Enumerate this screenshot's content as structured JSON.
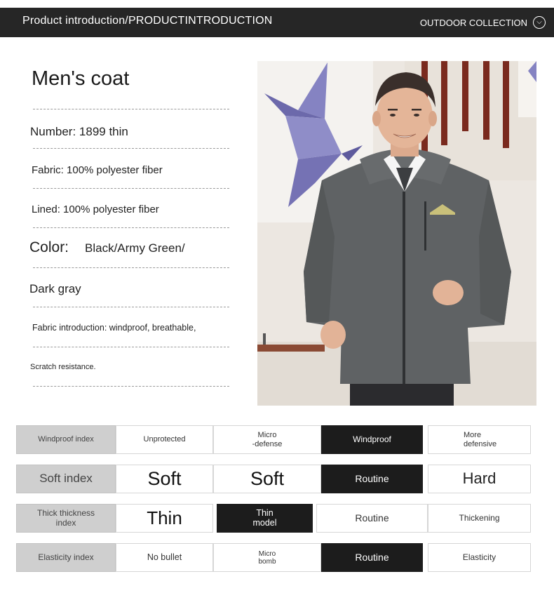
{
  "header": {
    "title": "Product introduction/PRODUCTINTRODUCTION",
    "right_label": "OUTDOOR COLLECTION",
    "right_icon": "chevron-down-icon"
  },
  "spec": {
    "title": "Men's coat",
    "number": "Number: 1899 thin",
    "fabric": "Fabric: 100% polyester fiber",
    "lined": "Lined: 100% polyester fiber",
    "color_label": "Color:",
    "color_value": "Black/Army Green/",
    "color_value_2": "Dark gray",
    "fabric_intro": "Fabric introduction: windproof, breathable,",
    "fabric_intro_2": "Scratch resistance."
  },
  "indices": {
    "windproof": {
      "label": "Windproof index",
      "options": [
        "Unprotected",
        "Micro\n-defense",
        "Windproof",
        "More\ndefensive"
      ],
      "selected": "Windproof"
    },
    "soft": {
      "label": "Soft index",
      "options": [
        "Soft",
        "Soft",
        "Routine",
        "Hard"
      ],
      "selected": "Routine"
    },
    "thickness": {
      "label": "Thick thickness\nindex",
      "options": [
        "Thin",
        "Thin\nmodel",
        "Routine",
        "Thickening"
      ],
      "selected": "Thin\nmodel"
    },
    "elasticity": {
      "label": "Elasticity index",
      "options": [
        "No bullet",
        "Micro\nbomb",
        "Routine",
        "Elasticity"
      ],
      "selected": "Routine"
    }
  },
  "colors": {
    "header_bg": "#262626",
    "selected_bg": "#1c1c1c",
    "label_bg": "#cfcfcf",
    "jacket": "#5f6264"
  }
}
